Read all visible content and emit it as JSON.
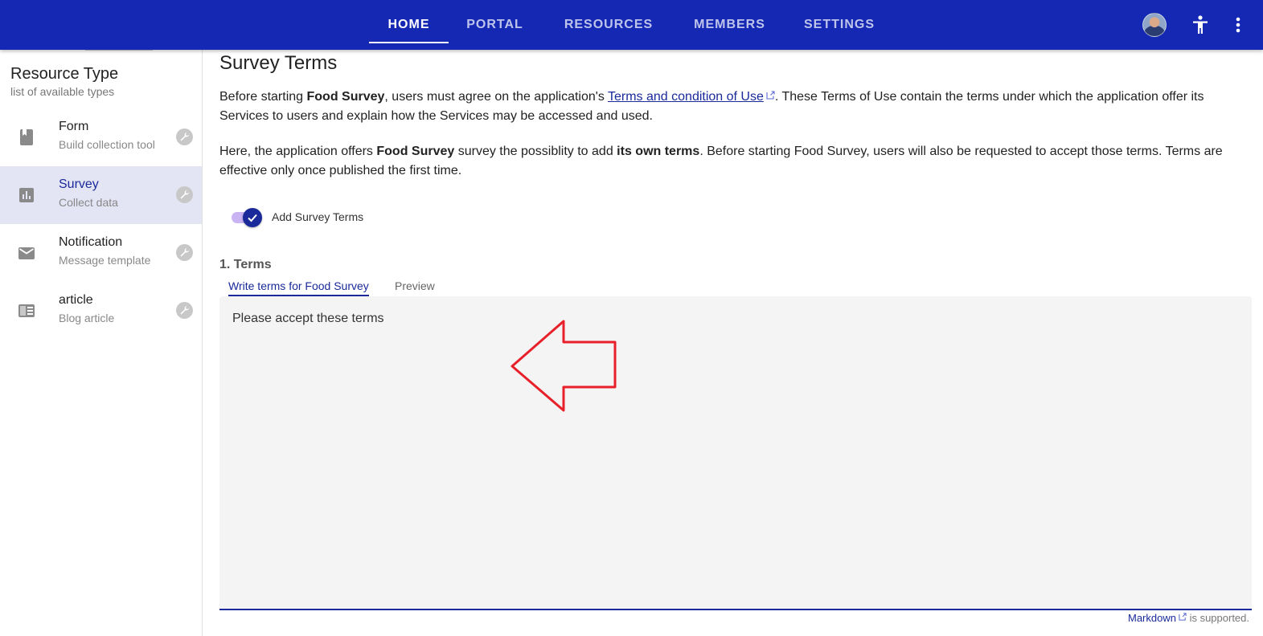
{
  "topbar": {
    "tabs": [
      {
        "label": "HOME",
        "active": true
      },
      {
        "label": "PORTAL",
        "active": false
      },
      {
        "label": "RESOURCES",
        "active": false
      },
      {
        "label": "MEMBERS",
        "active": false
      },
      {
        "label": "SETTINGS",
        "active": false
      }
    ],
    "icons": [
      "avatar",
      "accessibility-icon",
      "more-vert-icon"
    ]
  },
  "sidebar": {
    "title": "Resource Type",
    "subtitle": "list of available types",
    "items": [
      {
        "label": "Form",
        "description": "Build collection tool",
        "icon": "book-icon",
        "selected": false
      },
      {
        "label": "Survey",
        "description": "Collect data",
        "icon": "bar-chart-icon",
        "selected": true
      },
      {
        "label": "Notification",
        "description": "Message template",
        "icon": "mail-icon",
        "selected": false
      },
      {
        "label": "article",
        "description": "Blog article",
        "icon": "article-icon",
        "selected": false
      }
    ]
  },
  "main": {
    "title": "Survey Terms",
    "para1": {
      "t1": "Before starting ",
      "b1": "Food Survey",
      "t2": ", users must agree on the application's ",
      "link": "Terms and condition of Use",
      "t3": ". These Terms of Use contain the terms under which the application offer its Services to users and explain how the Services may be accessed and used."
    },
    "para2": {
      "t1": "Here, the application offers ",
      "b1": "Food Survey",
      "t2": " survey the possiblity to add ",
      "b2": "its own terms",
      "t3": ". Before starting Food Survey, users will also be requested to accept those terms. Terms are effective only once published the first time."
    },
    "toggle": {
      "label": "Add Survey Terms",
      "checked": true
    },
    "section_title": "1. Terms",
    "editor_tabs": [
      {
        "label": "Write terms for Food Survey",
        "active": true
      },
      {
        "label": "Preview",
        "active": false
      }
    ],
    "editor_text": "Please accept these terms",
    "hint": {
      "link": "Markdown",
      "text": " is supported."
    }
  },
  "colors": {
    "topbar": "#1428b4",
    "accent": "#1a2a9a",
    "selected_bg": "#e3e4f4",
    "annotation_arrow": "#e8202a"
  }
}
